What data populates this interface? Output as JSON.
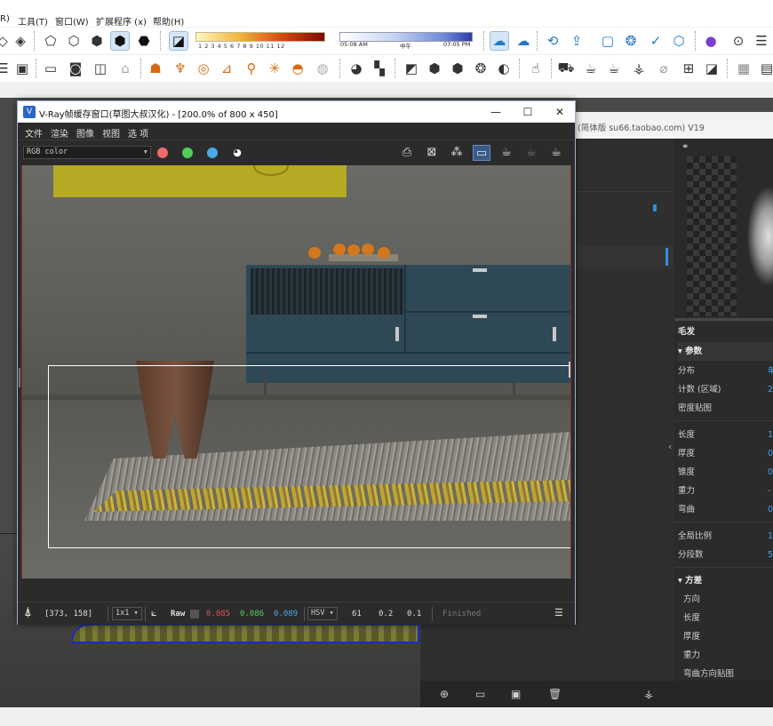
{
  "menubar": {
    "items": [
      "R)",
      "工具(T)",
      "窗口(W)",
      "扩展程序 (x)",
      "帮助(H)"
    ]
  },
  "shadows": {
    "scale_numbers": "1 2 3 4 5 6 7 8 9 10 11 12",
    "time_start": "05:08 AM",
    "time_mid": "中午",
    "time_end": "07:05 PM"
  },
  "vfb": {
    "title": "V-Ray帧缓存窗口(草图大叔汉化) - [200.0% of 800 x 450]",
    "menu": [
      "文件",
      "渲染",
      "图像",
      "视图",
      "选 项"
    ],
    "channel": "RGB color",
    "dot_colors": [
      "#f06a6a",
      "#4fcf5a",
      "#4aa8e8",
      "#ffffff"
    ],
    "status": {
      "coords": "[373, 158]",
      "zoom": "1x1",
      "mode": "Raw",
      "r": "0.085",
      "g": "0.086",
      "b": "0.089",
      "color_space": "HSV",
      "h": "61",
      "s": "0.2",
      "v": "0.1",
      "state": "Finished"
    },
    "colors": {
      "r": "#e05050",
      "g": "#4fcf5a",
      "b": "#4aa8e8"
    }
  },
  "tray": {
    "title": "(简体版 su66.taobao.com) V19",
    "section_title": "毛发",
    "group_params": "▾ 参数",
    "rows": [
      {
        "label": "分布",
        "value": "单"
      },
      {
        "label": "计数 (区域)",
        "value": "2"
      },
      {
        "label": "密度贴图",
        "value": ""
      },
      {
        "label": "长度",
        "value": "1"
      },
      {
        "label": "厚度",
        "value": "0"
      },
      {
        "label": "锥度",
        "value": "0"
      },
      {
        "label": "重力",
        "value": "-"
      },
      {
        "label": "弯曲",
        "value": "0"
      },
      {
        "label": "全局比例",
        "value": "1"
      },
      {
        "label": "分段数",
        "value": "5"
      }
    ],
    "group_variance": "▾ 方差",
    "variance_rows": [
      "方向",
      "长度",
      "厚度",
      "重力",
      "弯曲方向贴图"
    ]
  }
}
